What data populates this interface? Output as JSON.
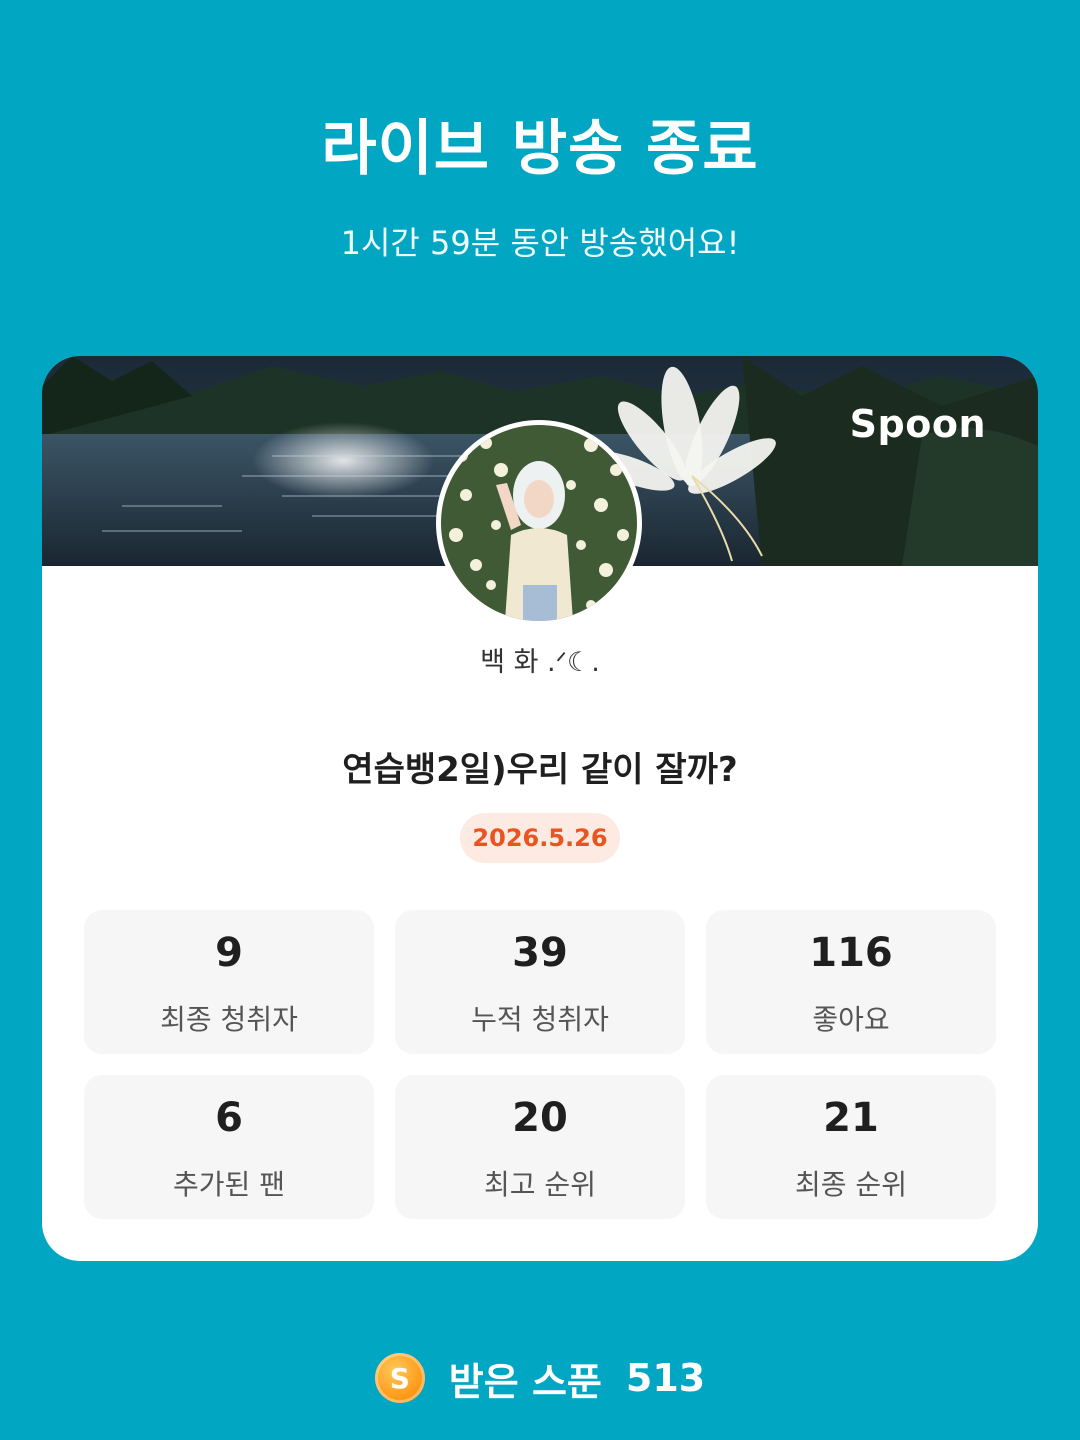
{
  "header": {
    "title": "라이브 방송 종료",
    "subtitle": "1시간 59분 동안 방송했어요!"
  },
  "card": {
    "brand": "Spoon",
    "nickname": "백 화 .ᐟ☾.",
    "show_title": "연습뱅2일)우리 같이 잘까?",
    "date": "2026.5.26",
    "stats": [
      {
        "value": "9",
        "label": "최종 청취자"
      },
      {
        "value": "39",
        "label": "누적 청취자"
      },
      {
        "value": "116",
        "label": "좋아요"
      },
      {
        "value": "6",
        "label": "추가된 팬"
      },
      {
        "value": "20",
        "label": "최고 순위"
      },
      {
        "value": "21",
        "label": "최종 순위"
      }
    ]
  },
  "footer": {
    "coin_symbol": "S",
    "label": "받은 스푼",
    "value": "513"
  },
  "colors": {
    "background": "#00A6C2",
    "date_text": "#E8551E",
    "date_bg": "#FDEAE3",
    "coin": "#FF9B1A"
  },
  "icons": {
    "coin": "spoon-coin-icon"
  }
}
